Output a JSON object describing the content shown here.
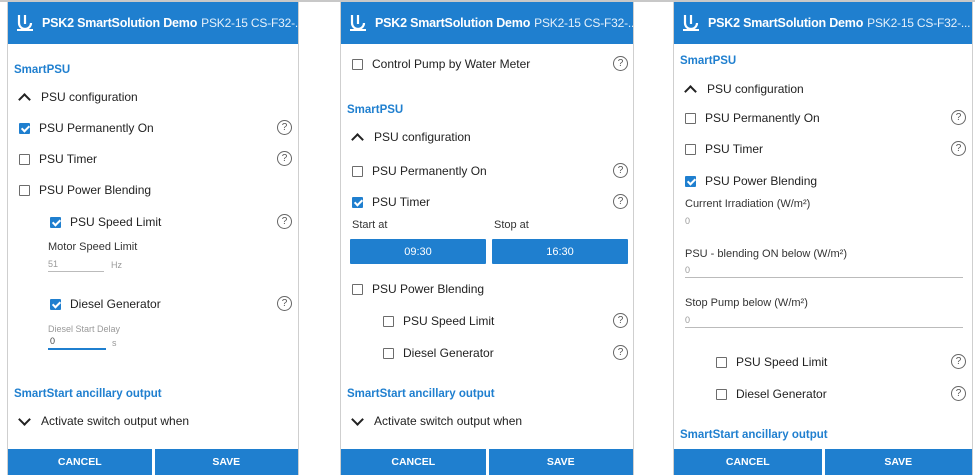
{
  "app": {
    "title": "PSK2 SmartSolution Demo",
    "device": "PSK2-15 CS-F32-..."
  },
  "colors": {
    "accent": "#1f7fcf"
  },
  "icons": {
    "app": "pump-logo-icon",
    "help": "help-circle-icon"
  },
  "footer": {
    "cancel": "CANCEL",
    "save": "SAVE"
  },
  "screen1": {
    "section_smartpsu": "SmartPSU",
    "psu_configuration": "PSU configuration",
    "psu_permanently_on": "PSU Permanently On",
    "psu_permanently_on_checked": true,
    "psu_timer": "PSU Timer",
    "psu_timer_checked": false,
    "psu_power_blending": "PSU Power Blending",
    "psu_power_blending_checked": false,
    "psu_speed_limit": "PSU Speed Limit",
    "psu_speed_limit_checked": true,
    "motor_speed_limit_label": "Motor Speed Limit",
    "motor_speed_limit_value": "51",
    "motor_speed_limit_unit": "Hz",
    "diesel_generator": "Diesel Generator",
    "diesel_generator_checked": true,
    "diesel_start_delay_label": "Diesel Start Delay",
    "diesel_start_delay_value": "0",
    "diesel_start_delay_unit": "s",
    "section_smartstart": "SmartStart ancillary output",
    "activate_switch": "Activate switch output when"
  },
  "screen2": {
    "control_pump": "Control Pump by Water Meter",
    "control_pump_checked": false,
    "section_smartpsu": "SmartPSU",
    "psu_configuration": "PSU configuration",
    "psu_permanently_on": "PSU Permanently On",
    "psu_permanently_on_checked": false,
    "psu_timer": "PSU Timer",
    "psu_timer_checked": true,
    "start_at_label": "Start at",
    "stop_at_label": "Stop at",
    "start_at_value": "09:30",
    "stop_at_value": "16:30",
    "psu_power_blending": "PSU Power Blending",
    "psu_power_blending_checked": false,
    "psu_speed_limit": "PSU Speed Limit",
    "psu_speed_limit_checked": false,
    "diesel_generator": "Diesel Generator",
    "diesel_generator_checked": false,
    "section_smartstart": "SmartStart ancillary output",
    "activate_switch": "Activate switch output when"
  },
  "screen3": {
    "section_smartpsu": "SmartPSU",
    "psu_configuration": "PSU configuration",
    "psu_permanently_on": "PSU Permanently On",
    "psu_permanently_on_checked": false,
    "psu_timer": "PSU Timer",
    "psu_timer_checked": false,
    "psu_power_blending": "PSU Power Blending",
    "psu_power_blending_checked": true,
    "current_irradiation_label": "Current Irradiation (W/m²)",
    "current_irradiation_value": "0",
    "blending_on_label": "PSU - blending ON below (W/m²)",
    "blending_on_value": "0",
    "stop_pump_label": "Stop Pump below (W/m²)",
    "stop_pump_value": "0",
    "psu_speed_limit": "PSU Speed Limit",
    "psu_speed_limit_checked": false,
    "diesel_generator": "Diesel Generator",
    "diesel_generator_checked": false,
    "section_smartstart": "SmartStart ancillary output"
  }
}
